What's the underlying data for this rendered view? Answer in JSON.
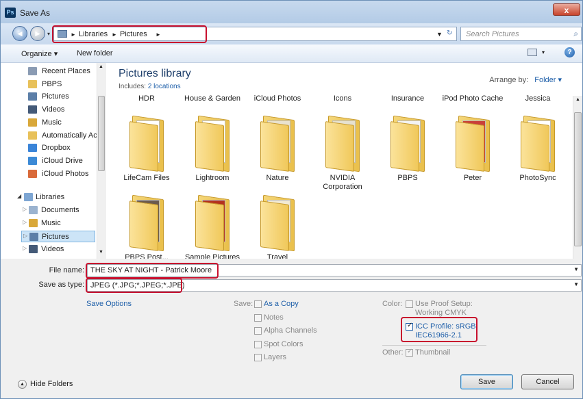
{
  "window": {
    "title": "Save As",
    "app_icon": "Ps",
    "close_label": "x"
  },
  "address": {
    "crumbs": [
      "Libraries",
      "Pictures"
    ],
    "search_placeholder": "Search Pictures"
  },
  "toolbar": {
    "organize_label": "Organize ▾",
    "new_folder_label": "New folder"
  },
  "nav": {
    "items": [
      {
        "label": "Recent Places",
        "color": "#8a9bb3"
      },
      {
        "label": "PBPS",
        "color": "#e8c15a"
      },
      {
        "label": "Pictures",
        "color": "#5c7fa8"
      },
      {
        "label": "Videos",
        "color": "#445a78"
      },
      {
        "label": "Music",
        "color": "#d9a83a"
      },
      {
        "label": "Automatically Ac",
        "color": "#e8c15a"
      },
      {
        "label": "Dropbox",
        "color": "#3a84d8"
      },
      {
        "label": "iCloud Drive",
        "color": "#3c8ad6"
      },
      {
        "label": "iCloud Photos",
        "color": "#d96a3a"
      }
    ],
    "libraries_label": "Libraries",
    "library_items": [
      {
        "label": "Documents",
        "color": "#9bb3cf"
      },
      {
        "label": "Music",
        "color": "#d9a83a"
      },
      {
        "label": "Pictures",
        "color": "#5c7fa8"
      },
      {
        "label": "Videos",
        "color": "#445a78"
      }
    ]
  },
  "content": {
    "title": "Pictures library",
    "includes_label": "Includes:",
    "includes_link": "2 locations",
    "arrange_label": "Arrange by:",
    "arrange_value": "Folder ▾",
    "top_row": [
      "HDR",
      "House & Garden",
      "iCloud Photos",
      "Icons",
      "Insurance",
      "iPod Photo Cache",
      "Jessica"
    ],
    "folders_row1": [
      "LifeCam Files",
      "Lightroom",
      "Nature",
      "NVIDIA Corporation",
      "PBPS",
      "Peter",
      "PhotoSync"
    ],
    "folders_row2": [
      "PBPS Post...",
      "Sample Pictures",
      "Travel"
    ]
  },
  "form": {
    "filename_label": "File name:",
    "filename_value": "THE SKY AT NIGHT  -  Patrick Moore",
    "savetype_label": "Save as type:",
    "savetype_value": "JPEG (*.JPG;*.JPEG;*.JPE)",
    "save_options": "Save Options",
    "save_label": "Save:",
    "as_copy": "As a Copy",
    "notes": "Notes",
    "alpha": "Alpha Channels",
    "spot": "Spot Colors",
    "layers": "Layers",
    "color_label": "Color:",
    "proof_line1": "Use Proof Setup:",
    "proof_line2": "Working CMYK",
    "icc_line1": "ICC Profile:  sRGB",
    "icc_line2": "IEC61966-2.1",
    "other_label": "Other:",
    "thumbnail": "Thumbnail",
    "hide_folders": "Hide Folders",
    "save_button": "Save",
    "cancel_button": "Cancel"
  },
  "colors": {
    "highlight_red": "#c8102e",
    "link_blue": "#1e5fa9"
  }
}
